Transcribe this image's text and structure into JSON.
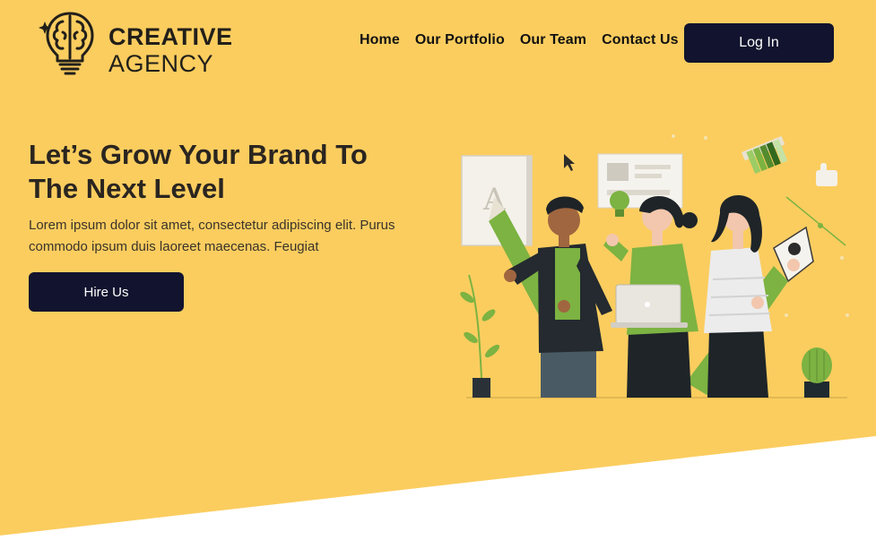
{
  "brand": {
    "line1": "CREATIVE",
    "line2": "AGENCY",
    "logo_icon": "brain-lightbulb-icon"
  },
  "nav": {
    "items": [
      {
        "label": "Home"
      },
      {
        "label": "Our Portfolio"
      },
      {
        "label": "Our Team"
      },
      {
        "label": "Contact Us"
      }
    ],
    "login_label": "Log In"
  },
  "hero": {
    "title": "Let’s Grow Your Brand To The Next Level",
    "text": "Lorem ipsum dolor sit amet, consectetur adipiscing elit. Purus commodo ipsum duis laoreet maecenas. Feugiat",
    "cta_label": "Hire Us",
    "illustration_letter": "A"
  },
  "colors": {
    "background": "#fbcd5f",
    "accent_green": "#7cb342",
    "button_dark": "#12132e",
    "text_dark": "#2a2520"
  }
}
